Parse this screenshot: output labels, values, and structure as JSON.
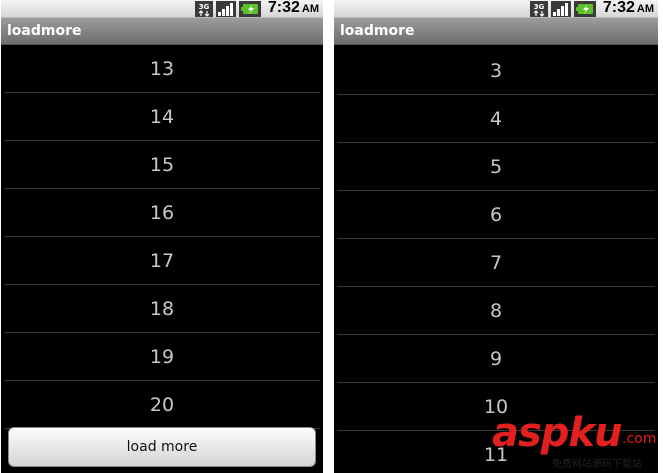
{
  "left_screen": {
    "status": {
      "time": "7:32",
      "ampm": "AM",
      "network": "3G"
    },
    "title": "loadmore",
    "items": [
      "13",
      "14",
      "15",
      "16",
      "17",
      "18",
      "19",
      "20"
    ],
    "load_more_label": "load more"
  },
  "right_screen": {
    "status": {
      "time": "7:32",
      "ampm": "AM",
      "network": "3G"
    },
    "title": "loadmore",
    "items": [
      "3",
      "4",
      "5",
      "6",
      "7",
      "8",
      "9",
      "10",
      "11"
    ]
  },
  "watermark": {
    "main": "aspku",
    "suffix": ".com",
    "sub": "免费网站源码下载站"
  },
  "colors": {
    "list_bg": "#000000",
    "item_text": "#c8c8c8",
    "title_bar": "#8a8a8a",
    "watermark": "#e31f1f"
  },
  "icons": [
    "network-3g-icon",
    "signal-bars-icon",
    "battery-charging-icon"
  ]
}
